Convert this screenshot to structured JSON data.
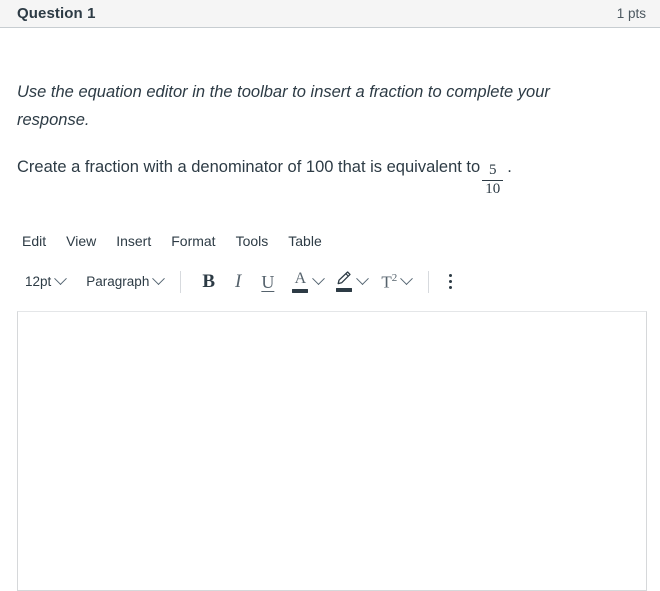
{
  "header": {
    "title": "Question 1",
    "points": "1 pts"
  },
  "prompt": {
    "instruction": "Use the equation editor in the toolbar to insert a fraction to complete your response.",
    "question_text": "Create a fraction with a denominator of 100 that is equivalent to",
    "fraction": {
      "numerator": "5",
      "denominator": "10"
    },
    "trailing_punctuation": "."
  },
  "editor": {
    "menus": [
      {
        "label": "Edit",
        "name": "edit"
      },
      {
        "label": "View",
        "name": "view"
      },
      {
        "label": "Insert",
        "name": "insert"
      },
      {
        "label": "Format",
        "name": "format"
      },
      {
        "label": "Tools",
        "name": "tools"
      },
      {
        "label": "Table",
        "name": "table"
      }
    ],
    "toolbar": {
      "font_size": "12pt",
      "block_format": "Paragraph",
      "bold_glyph": "B",
      "italic_glyph": "I",
      "underline_glyph": "U",
      "text_color_glyph": "A",
      "superscript_glyph": "T",
      "superscript_exponent": "2"
    },
    "content": ""
  },
  "colors": {
    "header_background": "#f5f5f5",
    "header_border": "#c7cdd1",
    "text": "#2d3b45",
    "muted_text": "#4c5860",
    "separator": "#d7dade",
    "editor_border": "#d6d8da"
  }
}
